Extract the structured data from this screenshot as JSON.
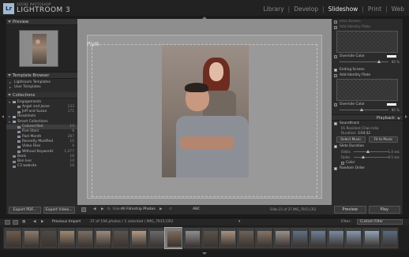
{
  "app": {
    "vendor": "ADOBE PHOTOSHOP",
    "name": "LIGHTROOM 3",
    "logo": "Lr"
  },
  "modules": [
    "Library",
    "Develop",
    "Slideshow",
    "Print",
    "Web"
  ],
  "active_module": "Slideshow",
  "left_panel": {
    "preview_header": "Preview",
    "template_browser_header": "Template Browser",
    "templates": [
      "Lightroom Templates",
      "User Templates"
    ],
    "collections_header": "Collections",
    "collections": [
      {
        "label": "Engagements",
        "count": ""
      },
      {
        "label": "Angel and Jesse",
        "count": "133"
      },
      {
        "label": "Jeff and Susan",
        "count": "171"
      },
      {
        "label": "Headshots",
        "count": ""
      },
      {
        "label": "Smart Collections",
        "count": ""
      },
      {
        "label": "Colored Red",
        "count": "14"
      },
      {
        "label": "Five Stars",
        "count": "8"
      },
      {
        "label": "Past Month",
        "count": "287"
      },
      {
        "label": "Recently Modified",
        "count": "10"
      },
      {
        "label": "Video Files",
        "count": "4"
      },
      {
        "label": "Without Keywords",
        "count": "1,077"
      },
      {
        "label": "Bank",
        "count": "16"
      },
      {
        "label": "Bon Iver",
        "count": "14"
      },
      {
        "label": "C3 website",
        "count": "16"
      }
    ],
    "export_pdf": "Export PDF...",
    "export_video": "Export Video..."
  },
  "canvas": {
    "identity_plate": "Plyth"
  },
  "toolbar": {
    "use_label": "Use:",
    "use_value": "All Filmstrip Photos",
    "abc": "ABC",
    "slide_counter": "Slide 21 of 37  IMG_7915.CR2"
  },
  "right_panel": {
    "intro_screen": "Intro Screen",
    "add_identity_plate": "Add Identity Plate",
    "override_color": "Override Color",
    "ending_screen": "Ending Screen",
    "add_identity_plate_2": "Add Identity Plate",
    "override_color_2": "Override Color",
    "playback_header": "Playback",
    "soundtrack": "Soundtrack",
    "soundtrack_file": "01 Resident Chair.m4a",
    "duration_label": "Duration:",
    "duration_value": "3:04:32",
    "select_music": "Select Music",
    "fit_to_music": "Fit to Music",
    "slide_duration": "Slide Duration",
    "slides_label": "Slides",
    "slides_value": "1.4 sec",
    "fades_label": "Fades",
    "fades_value": "0.5 sec",
    "color_label": "Color",
    "random_order": "Random Order",
    "preview_button": "Preview",
    "play_button": "Play",
    "slider_value": "80 %"
  },
  "filmstrip": {
    "source": "Previous Import",
    "count_text": "37 of 194 photos / 1 selected / IMG_7915.CR2",
    "filter_label": "Filter:",
    "custom_filter": "Custom Filter"
  },
  "colors": {
    "background": "#1b1b1b",
    "panel": "#2b2b2b",
    "canvas": "#8e8e8e",
    "active_module_text": "#e8e8e8"
  }
}
